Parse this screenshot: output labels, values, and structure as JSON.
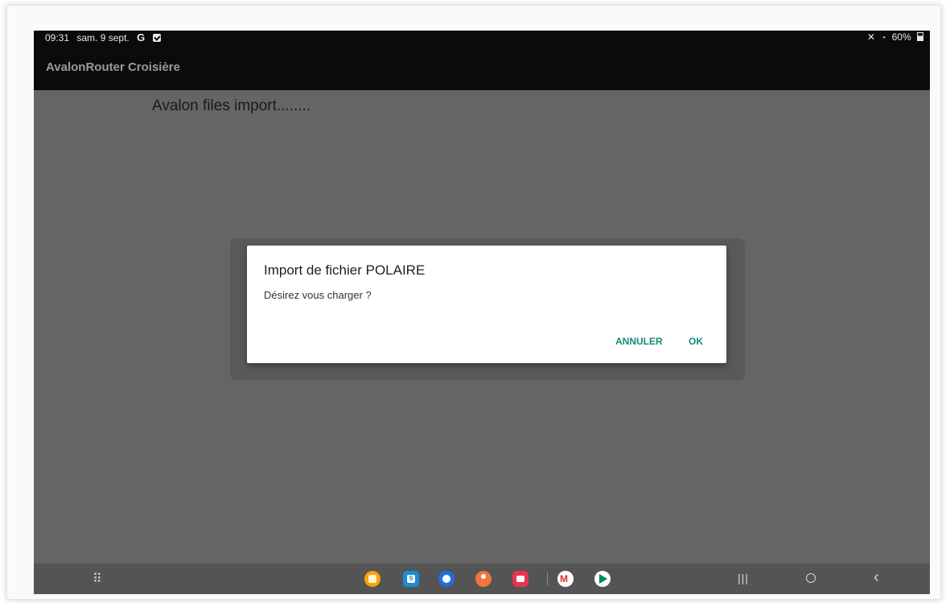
{
  "status_bar": {
    "time": "09:31",
    "date": "sam. 9 sept.",
    "google_glyph": "G",
    "battery": "60%",
    "icons": [
      "google-icon",
      "check-icon",
      "mute-icon",
      "wifi-icon",
      "battery-icon"
    ]
  },
  "app_bar": {
    "title": "AvalonRouter Croisière"
  },
  "content": {
    "status_text": "Avalon files import........"
  },
  "dialog": {
    "title": "Import de fichier POLAIRE",
    "message": "Désirez vous charger ?",
    "cancel_label": "ANNULER",
    "ok_label": "OK",
    "accent_color": "#168c7a"
  },
  "nav_bar": {
    "dock_apps": [
      {
        "name": "my-files-icon",
        "color": "#f5a500"
      },
      {
        "name": "calendar-icon",
        "color": "#1a8dd8",
        "label": "9"
      },
      {
        "name": "messages-icon",
        "color": "#1f6fe0"
      },
      {
        "name": "contacts-icon",
        "color": "#f0763a"
      },
      {
        "name": "screen-recorder-icon",
        "color": "#e5344f"
      },
      {
        "name": "gmail-icon",
        "color": "#ffffff"
      },
      {
        "name": "play-store-icon",
        "color": "#ffffff"
      }
    ],
    "buttons": [
      "app-drawer-icon",
      "recents-button",
      "home-button",
      "back-button"
    ]
  }
}
